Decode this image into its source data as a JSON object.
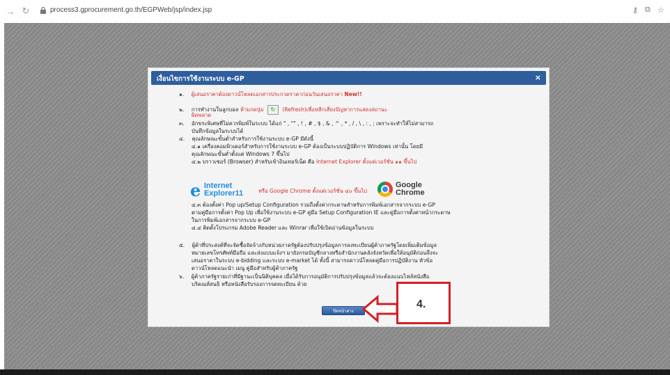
{
  "browser": {
    "url": "process3.gprocurement.go.th/EGPWeb/jsp/index.jsp",
    "icons": [
      "back-arrow-icon",
      "reload-icon",
      "lock-icon",
      "key-icon",
      "translate-icon",
      "star-icon"
    ]
  },
  "modal": {
    "title": "เงื่อนไขการใช้งานระบบ e-GP",
    "close_glyph": "×",
    "items": {
      "i1_num": "๑.",
      "i1_text": "ผู้เสนอราคาต้องดาวน์โหลดเอกสารประกวดราคาก่อนวันเสนอราคา",
      "i1_new": "New!!",
      "i2_num": "๒.",
      "i2_a": "การทำงานในลูกบอล",
      "i2_red": "ห้ามกดปุ่ม",
      "i2_b": "(Refresh)",
      "i2_c": "เพื่อหลีกเลี่ยงปัญหาการแสดงสถานะ",
      "i2_d": "ผิดพลาด",
      "i3_num": "๓.",
      "i3_a": "อักขระพิเศษที่ไม่ควรพิมพ์ในระบบ ได้แก่ \" , \"\" , ! , # , $ , & , ^ , * , / , \\ , : , ; เพราะจะทำให้ไม่สามารถ",
      "i3_b": "บันทึกข้อมูลในระบบได้",
      "i4_num": "๔.",
      "i4_text": "คุณลักษณะขั้นต่ำสำหรับการใช้งานระบบ e-GP มีดังนี้",
      "i4_1a": "๔.๑ เครื่องคอมพิวเตอร์สำหรับการใช้งานระบบ e-GP ต้องเป็นระบบปฏิบัติการ Windows เท่านั้น โดยมี",
      "i4_1b": "คุณลักษณะขั้นต่ำตั้งแต่ Windows 7 ขึ้นไป",
      "i4_2a": "๔.๒ บราวเซอร์ (Browser) สำหรับเข้าอินเทอร์เน็ต คือ",
      "i4_2b": "Internet Explorer ตั้งแต่เวอร์ชั่น ๑๑ ขึ้นไป",
      "ie_line1": "Internet",
      "ie_line2": "Explorer11",
      "i4_2c": "หรือ Google Chrome ตั้งแต่เวอร์ชั่น ๔๐ ขึ้นไป",
      "chrome_line1": "Google",
      "chrome_line2": "Chrome",
      "i4_3a": "๔.๓ ต้องตั้งค่า Pop up/Setup Configuration รวมถึงตั้งค่ากระดาษสำหรับการพิมพ์เอกสารจากระบบ e-GP",
      "i4_3b": "ตามคู่มือการตั้งค่า Pop Up เพื่อใช้งานระบบ e-GP คู่มือ Setup Configuration IE และคู่มือการตั้งค่าหน้ากระดาษ",
      "i4_3c": "ในการพิมพ์เอกสารจากระบบ e-GP",
      "i4_4": "๔.๔ ติดตั้งโปรแกรม Adobe Reader และ Winrar เพื่อใช้เปิดอ่านข้อมูลในระบบ",
      "i5_num": "๕.",
      "i5_a": "ผู้ค้าที่ประสงค์ที่จะจัดซื้อจัดจ้างกับหน่วยภาครัฐต้องปรับปรุงข้อมูลการลงทะเบียนผู้ค้าภาครัฐโดยเพิ่มเติมข้อมูล",
      "i5_b": "หมายเลขโทรศัพท์มือถือ และส่งแบบแจ้งฯ มายังกรมบัญชีกลางหรือสำนักงานคลังจังหวัดเพื่อให้อนุมัติก่อนจึงจะ",
      "i5_c": "เสนอราคาในระบบ e-bidding และระบบ e-market ได้ ทั้งนี้ สามารถดาวน์โหลดคู่มือการปฏิบัติงาน หัวข้อ",
      "i5_d": "ดาวน์โหลดแนะนำ เมนู คู่มือสำหรับผู้ค้าภาครัฐ",
      "i6_num": "๖.",
      "i6_a": "ผู้ค้าภาครัฐรายเก่าที่มีฐานะเป็นนิติบุคคล เมื่อได้รับการอนุมัติการปรับปรุงข้อมูลแล้วจะต้องแนบไฟล์หนังสือ",
      "i6_b": "บริคณห์สนธิ หรือหนังสือรับรองการจดทะเบียน ด้วย"
    },
    "close_button": "ปิดหน้าต่าง"
  },
  "annotation": {
    "label": "4.",
    "color": "#d31f26"
  }
}
